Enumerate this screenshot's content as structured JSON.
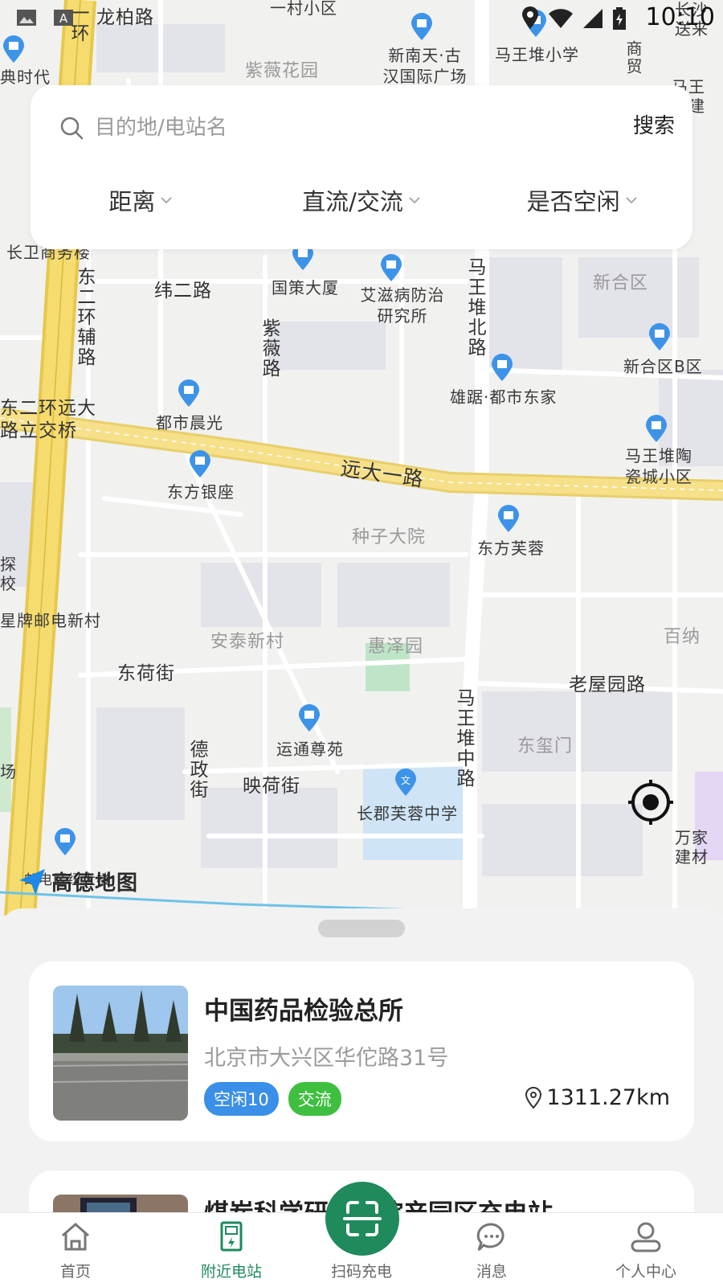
{
  "status_bar": {
    "time": "10:10"
  },
  "map": {
    "attribution": "高德地图",
    "road_labels": [
      "龙柏路",
      "一环",
      "纬二路",
      "东二环辅路",
      "紫薇路",
      "东二环远大路立交桥",
      "远大一路",
      "马王堆北路",
      "马王堆中路",
      "东荷街",
      "德政街",
      "映荷街",
      "老屋园路",
      "东二环"
    ],
    "area_labels": [
      "紫薇花园",
      "新合区",
      "种子大院",
      "安泰新村",
      "惠泽园",
      "东玺门",
      "百纳",
      "一村小区",
      "商贸"
    ],
    "poi_labels": [
      "典时代",
      "新南天·古汉国际广场",
      "马王堆小学",
      "长沙送来",
      "马王堆建材",
      "长卫商务楼",
      "国策大厦",
      "艾滋病防治研究所",
      "新合区B区",
      "都市晨光",
      "雄踞·都市东家",
      "东方银座",
      "马王堆陶瓷城小区",
      "东方芙蓉",
      "星牌邮电新村",
      "运通尊苑",
      "长郡芙蓉中学",
      "万家建材",
      "场",
      "探校",
      "邮电区纽大楼"
    ]
  },
  "search": {
    "placeholder": "目的地/电站名",
    "button_label": "搜索",
    "filters": [
      "距离",
      "直流/交流",
      "是否空闲"
    ]
  },
  "stations": [
    {
      "name": "中国药品检验总所",
      "address": "北京市大兴区华佗路31号",
      "tag_idle": "空闲10",
      "tag_type": "交流",
      "distance": "1311.27km"
    },
    {
      "name": "煤炭科学研究总院产园区充电站"
    }
  ],
  "tabs": {
    "home": "首页",
    "nearby": "附近电站",
    "scan": "扫码充电",
    "messages": "消息",
    "profile": "个人中心"
  },
  "colors": {
    "brand_green": "#1f8a5b",
    "tag_blue": "#3a8fe8",
    "tag_green": "#3fbf3f",
    "road_yellow": "#f7e08a",
    "poi_blue": "#3d93e8"
  }
}
